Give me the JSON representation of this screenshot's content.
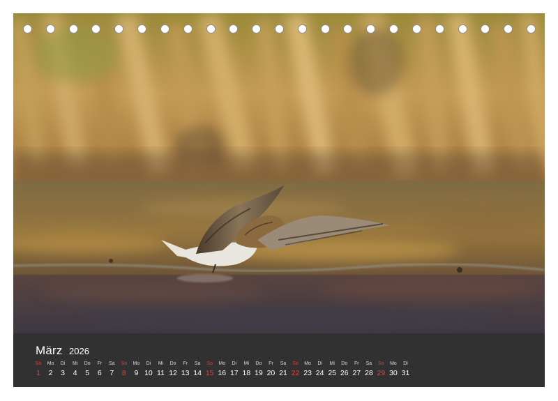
{
  "calendar": {
    "month": "März",
    "year": "2026",
    "days": [
      {
        "weekday": "So",
        "num": "1",
        "sunday": true
      },
      {
        "weekday": "Mo",
        "num": "2",
        "sunday": false
      },
      {
        "weekday": "Di",
        "num": "3",
        "sunday": false
      },
      {
        "weekday": "Mi",
        "num": "4",
        "sunday": false
      },
      {
        "weekday": "Do",
        "num": "5",
        "sunday": false
      },
      {
        "weekday": "Fr",
        "num": "6",
        "sunday": false
      },
      {
        "weekday": "Sa",
        "num": "7",
        "sunday": false
      },
      {
        "weekday": "So",
        "num": "8",
        "sunday": true
      },
      {
        "weekday": "Mo",
        "num": "9",
        "sunday": false
      },
      {
        "weekday": "Di",
        "num": "10",
        "sunday": false
      },
      {
        "weekday": "Mi",
        "num": "11",
        "sunday": false
      },
      {
        "weekday": "Do",
        "num": "12",
        "sunday": false
      },
      {
        "weekday": "Fr",
        "num": "13",
        "sunday": false
      },
      {
        "weekday": "Sa",
        "num": "14",
        "sunday": false
      },
      {
        "weekday": "So",
        "num": "15",
        "sunday": true
      },
      {
        "weekday": "Mo",
        "num": "16",
        "sunday": false
      },
      {
        "weekday": "Di",
        "num": "17",
        "sunday": false
      },
      {
        "weekday": "Mi",
        "num": "18",
        "sunday": false
      },
      {
        "weekday": "Do",
        "num": "19",
        "sunday": false
      },
      {
        "weekday": "Fr",
        "num": "20",
        "sunday": false
      },
      {
        "weekday": "Sa",
        "num": "21",
        "sunday": false
      },
      {
        "weekday": "So",
        "num": "22",
        "sunday": true
      },
      {
        "weekday": "Mo",
        "num": "23",
        "sunday": false
      },
      {
        "weekday": "Di",
        "num": "24",
        "sunday": false
      },
      {
        "weekday": "Mi",
        "num": "25",
        "sunday": false
      },
      {
        "weekday": "Do",
        "num": "26",
        "sunday": false
      },
      {
        "weekday": "Fr",
        "num": "27",
        "sunday": false
      },
      {
        "weekday": "Sa",
        "num": "28",
        "sunday": false
      },
      {
        "weekday": "So",
        "num": "29",
        "sunday": true
      },
      {
        "weekday": "Mo",
        "num": "30",
        "sunday": false
      },
      {
        "weekday": "Di",
        "num": "31",
        "sunday": false
      }
    ]
  },
  "binding": {
    "hole_count": 23
  },
  "colors": {
    "calendar_bar": "#313131",
    "sunday_red": "#e0413a",
    "text_white": "#ffffff"
  }
}
